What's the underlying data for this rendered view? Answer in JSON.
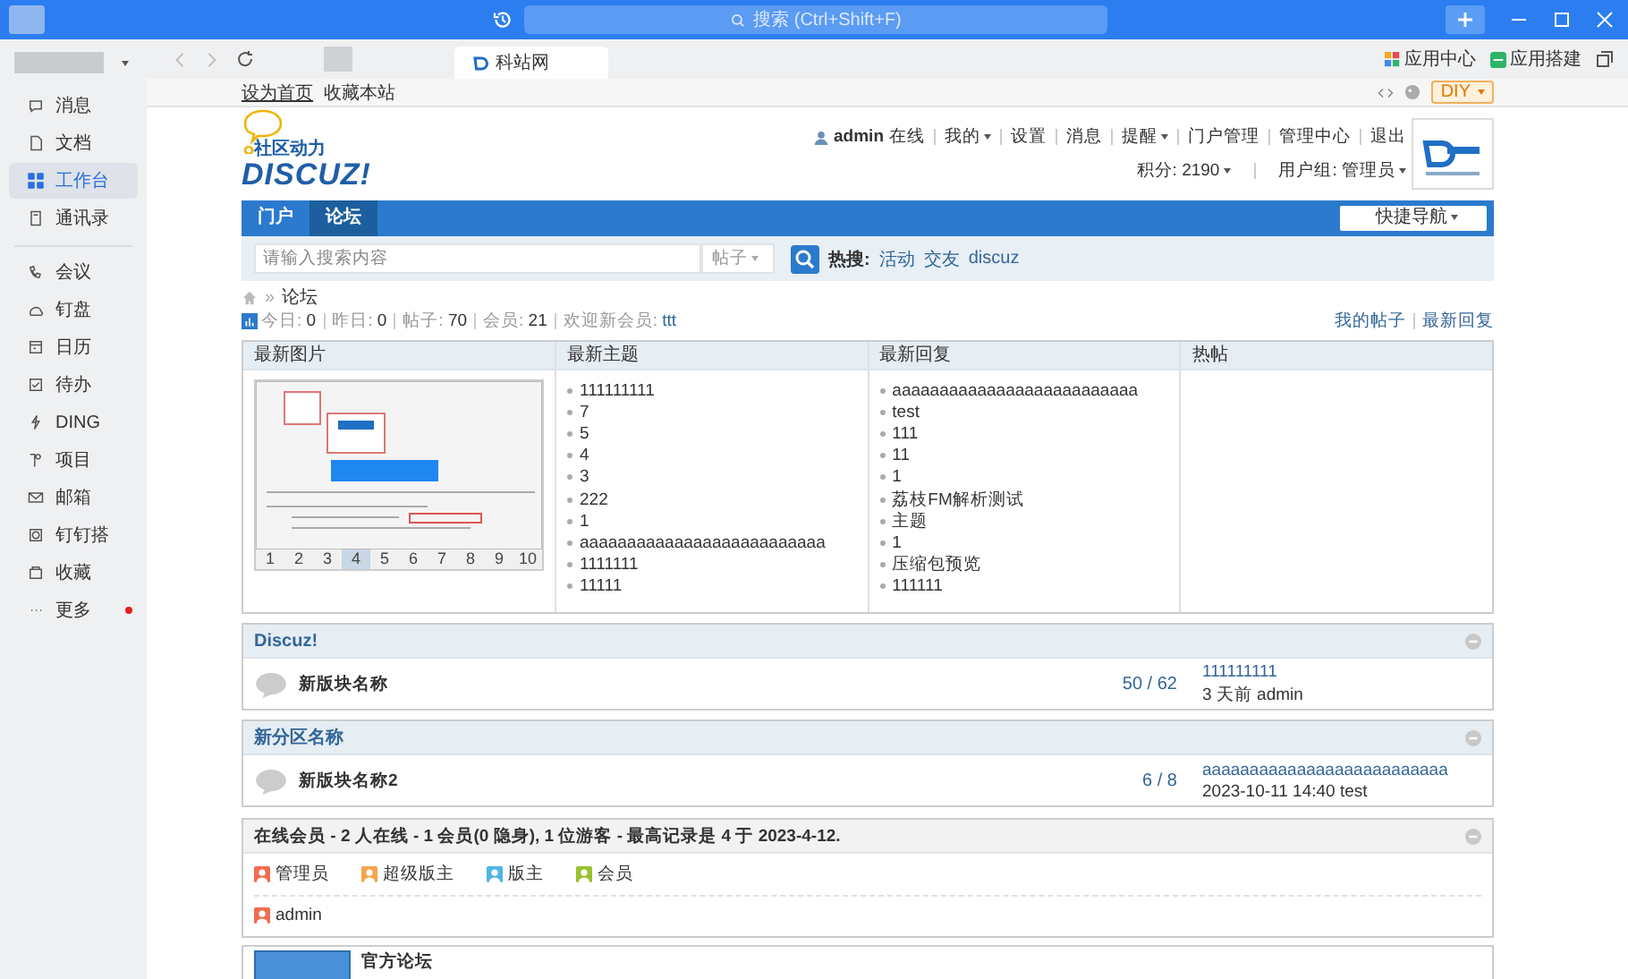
{
  "title_bar": {
    "search_placeholder": "搜索 (Ctrl+Shift+F)"
  },
  "sidebar": {
    "sections": [
      {
        "items": [
          {
            "label": "消息",
            "selected": false,
            "dot": false
          },
          {
            "label": "文档",
            "selected": false,
            "dot": false
          },
          {
            "label": "工作台",
            "selected": true,
            "dot": false
          },
          {
            "label": "通讯录",
            "selected": false,
            "dot": false
          }
        ]
      },
      {
        "items": [
          {
            "label": "会议",
            "selected": false,
            "dot": false
          },
          {
            "label": "钉盘",
            "selected": false,
            "dot": false
          },
          {
            "label": "日历",
            "selected": false,
            "dot": false
          },
          {
            "label": "待办",
            "selected": false,
            "dot": false
          },
          {
            "label": "DING",
            "selected": false,
            "dot": false
          },
          {
            "label": "项目",
            "selected": false,
            "dot": false
          },
          {
            "label": "邮箱",
            "selected": false,
            "dot": false
          },
          {
            "label": "钉钉搭",
            "selected": false,
            "dot": false
          },
          {
            "label": "收藏",
            "selected": false,
            "dot": false
          },
          {
            "label": "更多",
            "selected": false,
            "dot": true
          }
        ]
      }
    ]
  },
  "browser": {
    "tabs": [
      {
        "label": "科站网",
        "selected": true
      }
    ],
    "tools": [
      "应用中心",
      "应用搭建"
    ]
  },
  "page": {
    "top_links": [
      "设为首页",
      "收藏本站"
    ],
    "diy": "DIY",
    "logo": {
      "tagline": "社区动力",
      "name": "DISCUZ!"
    },
    "user": {
      "name": "admin",
      "status": "在线",
      "menu": [
        {
          "label": "我的",
          "dropdown": true
        },
        {
          "label": "设置",
          "dropdown": false
        },
        {
          "label": "消息",
          "dropdown": false
        },
        {
          "label": "提醒",
          "dropdown": true
        },
        {
          "label": "门户管理",
          "dropdown": false
        },
        {
          "label": "管理中心",
          "dropdown": false
        },
        {
          "label": "退出",
          "dropdown": false
        }
      ],
      "points": "积分: 2190",
      "group": "用户组: 管理员"
    },
    "nav": {
      "tabs": [
        {
          "label": "门户",
          "selected": false
        },
        {
          "label": "论坛",
          "selected": true
        }
      ],
      "quick_nav": "快捷导航"
    },
    "search": {
      "placeholder": "请输入搜索内容",
      "type": "帖子",
      "hot_label": "热搜:",
      "hot": [
        "活动",
        "交友",
        "discuz"
      ]
    },
    "breadcrumb": {
      "separator": "»",
      "current": "论坛"
    },
    "stats": {
      "items": [
        {
          "label": "今日:",
          "value": "0"
        },
        {
          "label": "昨日:",
          "value": "0"
        },
        {
          "label": "帖子:",
          "value": "70"
        },
        {
          "label": "会员:",
          "value": "21"
        },
        {
          "label": "欢迎新会员:",
          "value": "ttt"
        }
      ],
      "links": [
        "我的帖子",
        "最新回复"
      ]
    },
    "portal": {
      "columns": [
        "最新图片",
        "最新主题",
        "最新回复",
        "热帖"
      ],
      "pages": [
        {
          "label": "1",
          "selected": false
        },
        {
          "label": "2",
          "selected": false
        },
        {
          "label": "3",
          "selected": false
        },
        {
          "label": "4",
          "selected": true
        },
        {
          "label": "5",
          "selected": false
        },
        {
          "label": "6",
          "selected": false
        },
        {
          "label": "7",
          "selected": false
        },
        {
          "label": "8",
          "selected": false
        },
        {
          "label": "9",
          "selected": false
        },
        {
          "label": "10",
          "selected": false
        }
      ],
      "topics": [
        "111111111",
        "7",
        "5",
        "4",
        "3",
        "222",
        "1",
        "aaaaaaaaaaaaaaaaaaaaaaaaaa",
        "1111111",
        "11111"
      ],
      "replies": [
        "aaaaaaaaaaaaaaaaaaaaaaaaaa",
        "test",
        "111",
        "11",
        "1",
        "荔枝FM解析测试",
        "主题",
        "1",
        "压缩包预览",
        "111111"
      ]
    },
    "groups": [
      {
        "title": "Discuz!",
        "forums": [
          {
            "name": "新版块名称",
            "counts": "50 / 62",
            "last_title": "111111111",
            "last_meta": "3 天前 admin"
          }
        ]
      },
      {
        "title": "新分区名称",
        "forums": [
          {
            "name": "新版块名称2",
            "counts": "6 / 8",
            "last_title": "aaaaaaaaaaaaaaaaaaaaaaaaaa",
            "last_meta": "2023-10-11 14:40 test"
          }
        ]
      }
    ],
    "online": {
      "title": "在线会员 - 2 人在线 - 1 会员(0 隐身), 1 位游客 - 最高记录是 4 于 2023-4-12.",
      "legend": [
        {
          "label": "管理员",
          "color": "#f26c4f"
        },
        {
          "label": "超级版主",
          "color": "#f5a54a"
        },
        {
          "label": "版主",
          "color": "#4fb5e3"
        },
        {
          "label": "会员",
          "color": "#99c22c"
        }
      ],
      "members": [
        {
          "name": "admin",
          "color": "#f26c4f"
        }
      ]
    },
    "links_box": {
      "title": "官方论坛"
    }
  }
}
